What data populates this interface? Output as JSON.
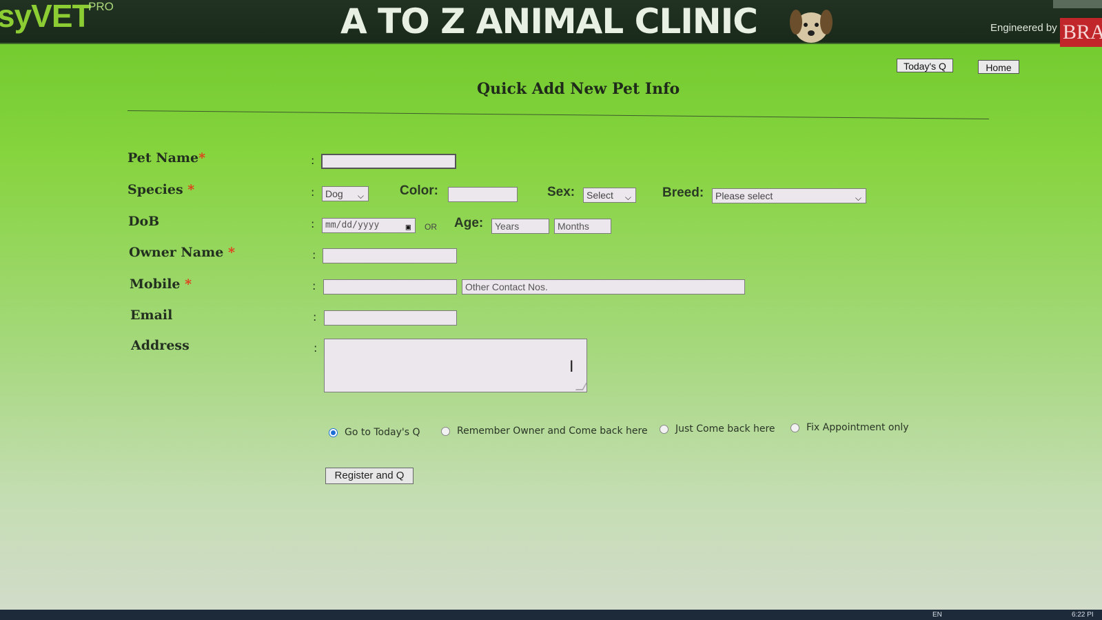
{
  "header": {
    "logo": "syVET",
    "logo_suffix": "PRO",
    "clinic_name": "A TO Z ANIMAL CLINIC",
    "engineered_by": "Engineered by",
    "brand": "BRAIN"
  },
  "top_buttons": {
    "todays_q": "Today's Q",
    "home": "Home"
  },
  "page_title": "Quick Add New Pet Info",
  "form": {
    "pet_name": {
      "label": "Pet Name",
      "required_mark": "*",
      "value": ""
    },
    "species": {
      "label": "Species",
      "required_mark": "*",
      "selected": "Dog"
    },
    "color": {
      "label": "Color:",
      "value": ""
    },
    "sex": {
      "label": "Sex:",
      "selected": "Select"
    },
    "breed": {
      "label": "Breed:",
      "selected": "Please select"
    },
    "dob": {
      "label": "DoB",
      "placeholder": "mm/dd/yyyy"
    },
    "or_text": "OR",
    "age": {
      "label": "Age:",
      "years_placeholder": "Years",
      "months_placeholder": "Months"
    },
    "owner_name": {
      "label": "Owner Name",
      "required_mark": "*",
      "value": ""
    },
    "mobile": {
      "label": "Mobile",
      "required_mark": "*",
      "value": "",
      "other_placeholder": "Other Contact Nos."
    },
    "email": {
      "label": "Email",
      "value": ""
    },
    "address": {
      "label": "Address",
      "value": ""
    },
    "colon": ":"
  },
  "options": [
    {
      "label": "Go to Today's Q",
      "checked": true
    },
    {
      "label": "Remember Owner and Come back here",
      "checked": false
    },
    {
      "label": "Just Come back here",
      "checked": false
    },
    {
      "label": "Fix Appointment only",
      "checked": false
    }
  ],
  "submit_label": "Register and Q",
  "taskbar": {
    "lang": "EN",
    "time": "6:22 PI"
  }
}
